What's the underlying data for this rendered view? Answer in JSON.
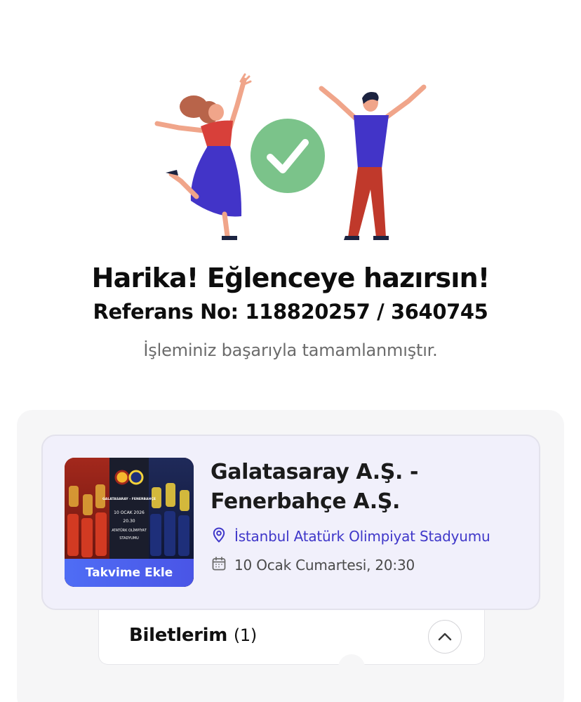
{
  "success": {
    "headline": "Harika! Eğlenceye hazırsın!",
    "reference": "Referans No: 118820257 / 3640745",
    "message": "İşleminiz başarıyla tamamlanmıştır."
  },
  "event": {
    "title_line1": "Galatasaray A.Ş. -",
    "title_line2": "Fenerbahçe A.Ş.",
    "venue": "İstanbul Atatürk Olimpiyat Stadyumu",
    "datetime": "10 Ocak Cumartesi, 20:30",
    "calendar_button": "Takvime Ekle",
    "poster_text": {
      "matchup": "GALATASARAY - FENERBAHÇE",
      "date": "10 OCAK 2026",
      "time": "20.30",
      "stadium_line1": "ATATÜRK OLİMPİYAT",
      "stadium_line2": "STADYUMU"
    }
  },
  "tickets": {
    "label": "Biletlerim",
    "count": "(1)"
  },
  "colors": {
    "accent": "#3f37c9",
    "success_green": "#7bc38a",
    "button_blue": "#4f6df5"
  },
  "icons": {
    "success": "check-circle-icon",
    "venue": "location-pin-icon",
    "date": "calendar-icon",
    "collapse": "chevron-up-icon"
  }
}
